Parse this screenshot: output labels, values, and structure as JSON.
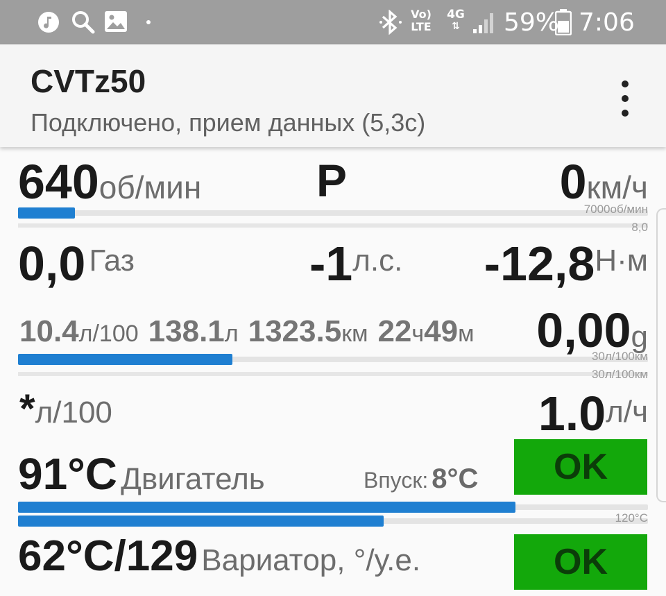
{
  "status_bar": {
    "left_icons": [
      "music-icon",
      "search-icon",
      "image-icon",
      "dot-icon"
    ],
    "right_icons": [
      "bluetooth-icon",
      "volte-icon",
      "4g-icon",
      "signal-icon",
      "battery-icon"
    ],
    "volte_line1": "Vo)",
    "volte_line2": "LTE",
    "net_label": "4G",
    "battery": "59%",
    "time": "7:06"
  },
  "app_bar": {
    "title": "CVTz50",
    "subtitle": "Подключено, прием данных (5,3с)",
    "menu_icon": "more-vert-icon"
  },
  "rpm": {
    "value": "640",
    "unit": "об/мин",
    "max_label": "7000об/мин",
    "fill_fraction": 0.09
  },
  "gear": {
    "value": "P"
  },
  "speed": {
    "value": "0",
    "unit": "км/ч"
  },
  "throttle": {
    "value": "0,0",
    "label": "Газ",
    "max_label": "8,0"
  },
  "power": {
    "value": "-1",
    "unit": "л.с."
  },
  "torque": {
    "value": "-12,8",
    "unit": "Н·м"
  },
  "trip": {
    "avg_consumption": "10.4",
    "avg_unit": "л/100",
    "fuel_used": "138.1",
    "fuel_unit": "л",
    "distance": "1323.5",
    "distance_unit": "км",
    "hours": "22",
    "hours_unit": "ч",
    "minutes": "49",
    "minutes_unit": "м",
    "fill_fraction": 0.34,
    "max_label_1": "30л/100км",
    "max_label_2": "30л/100км"
  },
  "g_force": {
    "value": "0,00",
    "unit": "g"
  },
  "instant": {
    "left_value": "*",
    "left_unit": "л/100",
    "right_value": "1.0",
    "right_unit": "л/ч"
  },
  "engine_temp": {
    "value": "91°C",
    "label": "Двигатель",
    "intake_label": "Впуск:",
    "intake_value": "8°C",
    "status": "OK",
    "status_color": "#13a80b",
    "fill_fraction": 0.79,
    "fill2_fraction": 0.58,
    "max_label": "120°C"
  },
  "cvt_temp": {
    "value": "62°C/129",
    "label": "Вариатор, °/у.е.",
    "status": "OK",
    "status_color": "#13a80b"
  },
  "colors": {
    "accent": "#1f7fd1",
    "ok": "#13a80b",
    "status_bar": "#9e9e9e"
  }
}
